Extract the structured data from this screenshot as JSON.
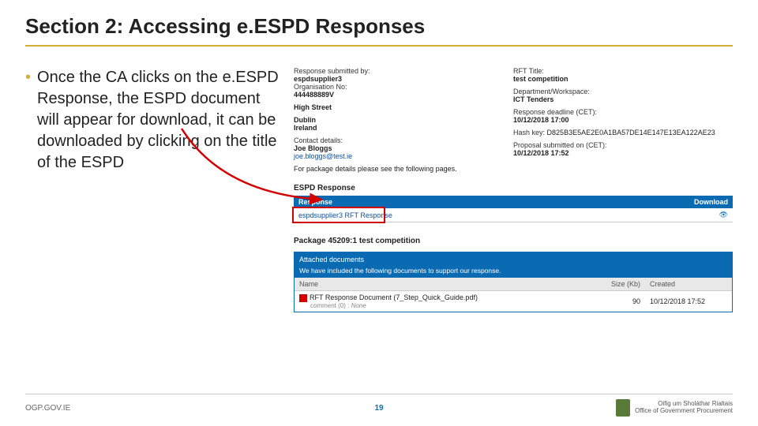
{
  "title": "Section 2: Accessing e.ESPD Responses",
  "bullet": "Once the CA clicks on the e.ESPD Response, the ESPD document will appear for download, it can be downloaded by clicking on the title of the ESPD",
  "info": {
    "left": {
      "l1": "Response submitted by:",
      "v1": "espdsupplier3",
      "l2": "Organisation No:",
      "v2": "444488889V",
      "addr1": "High Street",
      "addr2": "Dublin",
      "addr3": "Ireland",
      "l3": "Contact details:",
      "v3": "Joe Bloggs",
      "email": "joe.bloggs@test.ie"
    },
    "right": {
      "l1": "RFT Title:",
      "v1": "test competition",
      "l2": "Department/Workspace:",
      "v2": "ICT Tenders",
      "l3": "Response deadline (CET):",
      "v3": "10/12/2018 17:00",
      "l4": "Hash key:",
      "v4": "D825B3E5AE2E0A1BA57DE14E147E13EA122AE23",
      "l5": "Proposal submitted on (CET):",
      "v5": "10/12/2018 17:52"
    },
    "note": "For package details please see the following pages."
  },
  "resp_section": "ESPD Response",
  "resp_table": {
    "h1": "Response",
    "h2": "Download",
    "row": "espdsupplier3 RFT Response",
    "eye": "👁"
  },
  "pkg": "Package 45209:1    test competition",
  "att": {
    "head": "Attached documents",
    "sub": "We have included the following documents to support our response.",
    "h1": "Name",
    "h2": "Size (Kb)",
    "h3": "Created",
    "doc": "RFT Response Document (7_Step_Quick_Guide.pdf)",
    "cmt_lbl": "comment (0) :",
    "cmt_val": "None",
    "size": "90",
    "created": "10/12/2018 17:52"
  },
  "footer": {
    "left": "OGP.GOV.IE",
    "page": "19",
    "right1": "Oifig um Sholáthar Rialtais",
    "right2": "Office of Government Procurement"
  }
}
